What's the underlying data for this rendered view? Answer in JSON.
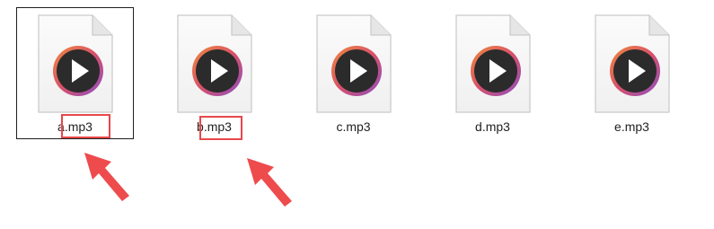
{
  "files": [
    {
      "name": "a.mp3",
      "selected": true,
      "icon": "audio-file-icon"
    },
    {
      "name": "b.mp3",
      "selected": false,
      "icon": "audio-file-icon"
    },
    {
      "name": "c.mp3",
      "selected": false,
      "icon": "audio-file-icon"
    },
    {
      "name": "d.mp3",
      "selected": false,
      "icon": "audio-file-icon"
    },
    {
      "name": "e.mp3",
      "selected": false,
      "icon": "audio-file-icon"
    }
  ],
  "annotations": {
    "highlight_color": "#e8484a",
    "highlighted_text": ".mp3"
  }
}
